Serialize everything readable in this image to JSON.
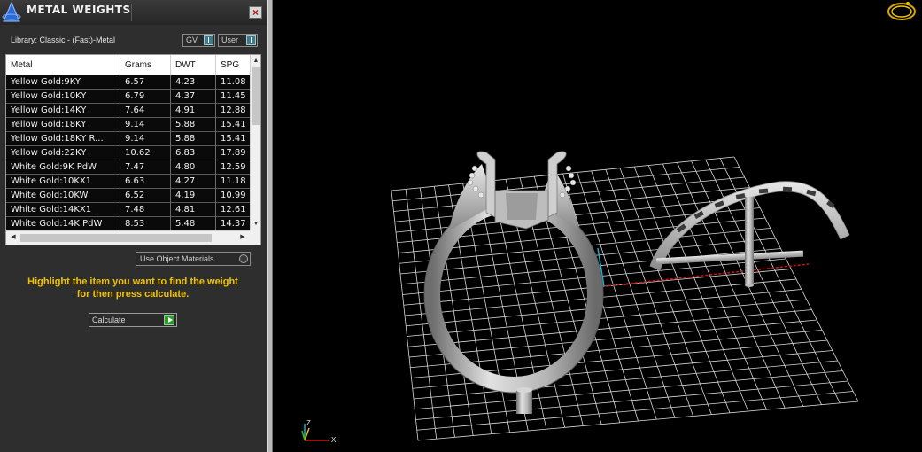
{
  "panel": {
    "title": "METAL WEIGHTS",
    "close_glyph": "×",
    "library_label": "Library: Classic - (Fast)-Metal",
    "gv_select": "GV",
    "user_select": "User",
    "columns": [
      "Metal",
      "Grams",
      "DWT",
      "SPG"
    ],
    "rows": [
      [
        "Yellow Gold:9KY",
        "6.57",
        "4.23",
        "11.08"
      ],
      [
        "Yellow Gold:10KY",
        "6.79",
        "4.37",
        "11.45"
      ],
      [
        "Yellow Gold:14KY",
        "7.64",
        "4.91",
        "12.88"
      ],
      [
        "Yellow Gold:18KY",
        "9.14",
        "5.88",
        "15.41"
      ],
      [
        "Yellow Gold:18KY R...",
        "9.14",
        "5.88",
        "15.41"
      ],
      [
        "Yellow Gold:22KY",
        "10.62",
        "6.83",
        "17.89"
      ],
      [
        "White Gold:9K PdW",
        "7.47",
        "4.80",
        "12.59"
      ],
      [
        "White Gold:10KX1",
        "6.63",
        "4.27",
        "11.18"
      ],
      [
        "White Gold:10KW",
        "6.52",
        "4.19",
        "10.99"
      ],
      [
        "White Gold:14KX1",
        "7.48",
        "4.81",
        "12.61"
      ],
      [
        "White Gold:14K PdW",
        "8.53",
        "5.48",
        "14.37"
      ]
    ],
    "object_materials_label": "Use Object Materials",
    "hint_line1": "Highlight the item you want to find the weight",
    "hint_line2": "for then press calculate.",
    "calculate_label": "Calculate"
  },
  "viewport": {
    "axis_labels": {
      "z": "Z",
      "x": "X"
    },
    "colors": {
      "grid": "#d8d8d8",
      "x_axis": "#d01414",
      "y_axis": "#16b4c8",
      "model": "#c8c8c8"
    }
  }
}
